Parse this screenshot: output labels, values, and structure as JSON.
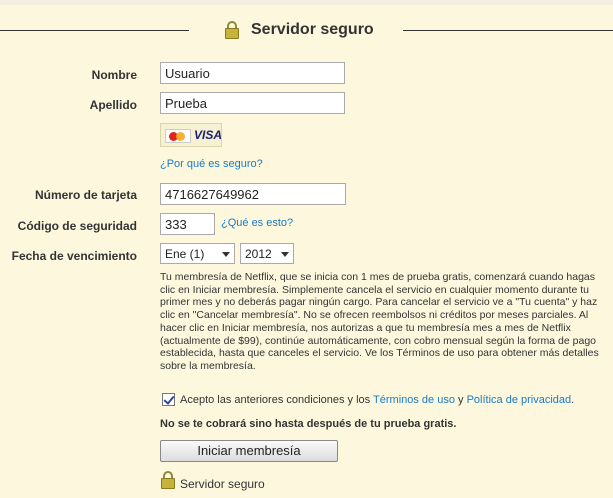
{
  "header": {
    "title": "Servidor seguro",
    "icon": "lock-icon"
  },
  "form": {
    "first_name": {
      "label": "Nombre",
      "value": "Usuario"
    },
    "last_name": {
      "label": "Apellido",
      "value": "Prueba"
    },
    "cards": {
      "mastercard": "MasterCard",
      "visa": "VISA"
    },
    "why_secure_link": "¿Por qué es seguro?",
    "card_number": {
      "label": "Número de tarjeta",
      "value": "4716627649962"
    },
    "security_code": {
      "label": "Código de seguridad",
      "value": "333",
      "help_link": "¿Qué es esto?"
    },
    "expiry": {
      "label": "Fecha de vencimiento",
      "month": "Ene (1)",
      "year": "2012"
    }
  },
  "terms_text": "Tu membresía de Netflix, que se inicia con 1 mes de prueba gratis, comenzará cuando hagas clic en Iniciar membresía. Simplemente cancela el servicio en cualquier momento durante tu primer mes y no deberás pagar ningún cargo. Para cancelar el servicio ve a \"Tu cuenta\" y haz clic en \"Cancelar membresía\". No se ofrecen reembolsos ni créditos por meses parciales. Al hacer clic en Iniciar membresía, nos autorizas a que tu membresía mes a mes de Netflix (actualmente de $99), continúe automáticamente, con cobro mensual según la forma de pago establecida, hasta que canceles el servicio. Ve los Términos de uso para obtener más detalles sobre la membresía.",
  "agree": {
    "checked": true,
    "prefix": "Acepto las anteriores condiciones y los",
    "terms_link": "Términos de uso",
    "conjunction": "y",
    "privacy_link": "Política de privacidad",
    "suffix": "."
  },
  "note": "No se te cobrará sino hasta después de tu prueba gratis.",
  "submit_label": "Iniciar membresía",
  "footer": {
    "secure_text": "Servidor seguro"
  }
}
